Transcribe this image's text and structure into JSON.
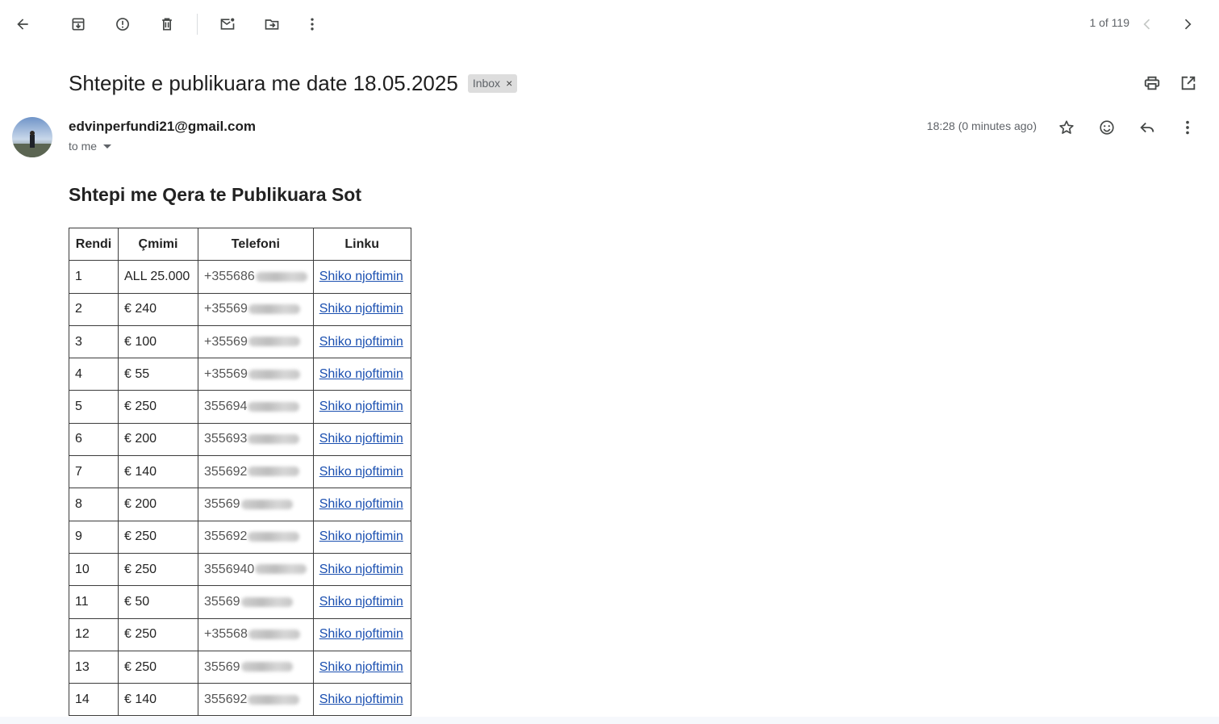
{
  "toolbar": {
    "icons": [
      "back-arrow-icon",
      "archive-icon",
      "report-spam-icon",
      "delete-icon",
      "mark-unread-icon",
      "move-to-icon",
      "more-vert-icon"
    ],
    "pager_text": "1 of 119"
  },
  "email": {
    "subject": "Shtepite e publikuara me date 18.05.2025",
    "label": "Inbox",
    "label_close": "×",
    "sender": "edvinperfundi21@gmail.com",
    "to": "to me",
    "time": "18:28 (0 minutes ago)"
  },
  "body": {
    "title": "Shtepi me Qera te Publikuara Sot",
    "columns": [
      "Rendi",
      "Çmimi",
      "Telefoni",
      "Linku"
    ],
    "rows": [
      {
        "rendi": "1",
        "cmimi": "ALL 25.000",
        "telefoni": "+355686",
        "link": "Shiko njoftimin"
      },
      {
        "rendi": "2",
        "cmimi": "€ 240",
        "telefoni": "+35569",
        "link": "Shiko njoftimin"
      },
      {
        "rendi": "3",
        "cmimi": "€ 100",
        "telefoni": "+35569",
        "link": "Shiko njoftimin"
      },
      {
        "rendi": "4",
        "cmimi": "€ 55",
        "telefoni": "+35569",
        "link": "Shiko njoftimin"
      },
      {
        "rendi": "5",
        "cmimi": "€ 250",
        "telefoni": "355694",
        "link": "Shiko njoftimin"
      },
      {
        "rendi": "6",
        "cmimi": "€ 200",
        "telefoni": "355693",
        "link": "Shiko njoftimin"
      },
      {
        "rendi": "7",
        "cmimi": "€ 140",
        "telefoni": "355692",
        "link": "Shiko njoftimin"
      },
      {
        "rendi": "8",
        "cmimi": "€ 200",
        "telefoni": "35569",
        "link": "Shiko njoftimin"
      },
      {
        "rendi": "9",
        "cmimi": "€ 250",
        "telefoni": "355692",
        "link": "Shiko njoftimin"
      },
      {
        "rendi": "10",
        "cmimi": "€ 250",
        "telefoni": "3556940",
        "link": "Shiko njoftimin"
      },
      {
        "rendi": "11",
        "cmimi": "€ 50",
        "telefoni": "35569",
        "link": "Shiko njoftimin"
      },
      {
        "rendi": "12",
        "cmimi": "€ 250",
        "telefoni": "+35568",
        "link": "Shiko njoftimin"
      },
      {
        "rendi": "13",
        "cmimi": "€ 250",
        "telefoni": "35569",
        "link": "Shiko njoftimin"
      },
      {
        "rendi": "14",
        "cmimi": "€ 140",
        "telefoni": "355692",
        "link": "Shiko njoftimin"
      }
    ]
  },
  "colors": {
    "link": "#1a4fb0",
    "chip_bg": "#dddddd",
    "icon": "#444746"
  }
}
